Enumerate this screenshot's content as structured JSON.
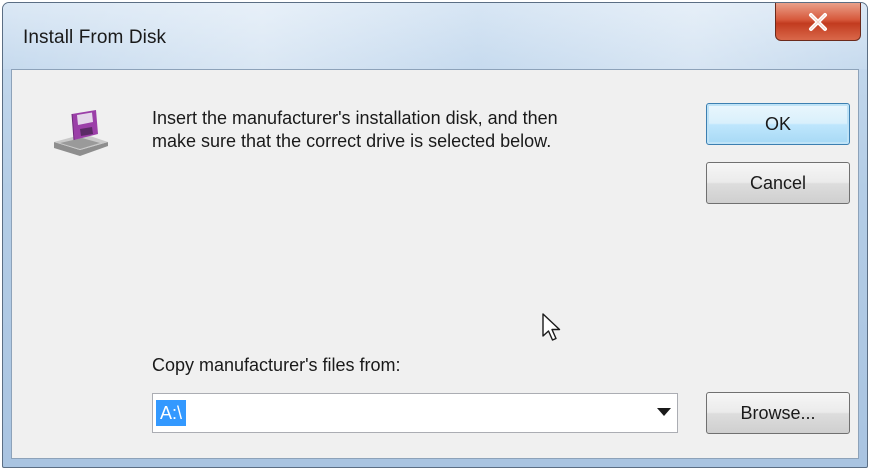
{
  "window": {
    "title": "Install From Disk"
  },
  "message": {
    "line1": "Insert the manufacturer's installation disk, and then",
    "line2": "make sure that the correct drive is selected below."
  },
  "buttons": {
    "ok_label": "OK",
    "cancel_label": "Cancel",
    "browse_label": "Browse..."
  },
  "copy_from": {
    "label": "Copy manufacturer's files from:",
    "value": "A:\\"
  },
  "icons": {
    "close": "close-icon",
    "disk": "floppy-disk-drive-icon",
    "dropdown": "chevron-down-icon",
    "cursor": "mouse-pointer-icon"
  },
  "colors": {
    "close_button": "#c94a2c",
    "selection": "#3399ff",
    "ok_border": "#3c7fb1"
  }
}
